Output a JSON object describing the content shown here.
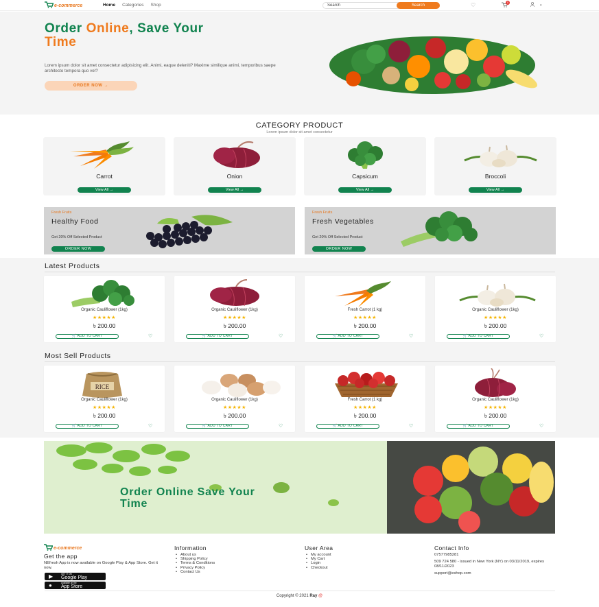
{
  "brand": {
    "name": "e-commerce",
    "colors": {
      "primary_green": "#11834f",
      "accent_orange": "#ef7a1d",
      "star": "#f5b400",
      "hero_bg": "#f4f4f4"
    }
  },
  "nav": {
    "links": [
      {
        "label": "Home",
        "active": true
      },
      {
        "label": "Categories",
        "active": false
      },
      {
        "label": "Shop",
        "active": false
      }
    ],
    "search": {
      "value": "Search",
      "button_label": "Search"
    },
    "icons": [
      "heart-icon",
      "cart-icon",
      "user-icon",
      "chevron-down-icon"
    ],
    "cart_count": "0"
  },
  "hero": {
    "title_part1": "Order ",
    "title_highlight": "Online",
    "title_part2": ", Save Your",
    "title_line3": "Time",
    "description": "Lorem ipsum dolor sit amet consectetur adipisicing elit. Animi, eaque deleniti? Maxime similique animi, temporibus saepe architecto tempora quo vel?",
    "button_label": "ORDER NOW →"
  },
  "category": {
    "title": "CATEGORY PRODUCT",
    "subtitle": "Lorem ipsum dolor sit amet consectetur",
    "items": [
      {
        "name": "Carrot",
        "button_label": "View All →",
        "icon": "carrot-icon"
      },
      {
        "name": "Onion",
        "button_label": "View All →",
        "icon": "onion-icon"
      },
      {
        "name": "Capsicum",
        "button_label": "View All →",
        "icon": "broccoli-icon"
      },
      {
        "name": "Broccoli",
        "button_label": "View All →",
        "icon": "garlic-icon"
      }
    ]
  },
  "promos": [
    {
      "tag": "Fresh Fruits",
      "title": "Healthy Food",
      "description": "Get 20% Off Selected Product",
      "button_label": "ORDER NOW",
      "icon": "grapes-icon"
    },
    {
      "tag": "Fresh Fruits",
      "title": "Fresh Vegetables",
      "description": "Get 20% Off Selected Product",
      "button_label": "ORDER NOW",
      "icon": "broccoli-icon"
    }
  ],
  "latest": {
    "heading": "Latest Products",
    "items": [
      {
        "name": "Organic Cauliflower (1kg)",
        "price": "৳ 200.00",
        "rating": 5,
        "cart_label": "ADD TO CART",
        "icon": "broccoli-icon"
      },
      {
        "name": "Organic Cauliflower (1kg)",
        "price": "৳ 200.00",
        "rating": 5,
        "cart_label": "ADD TO CART",
        "icon": "onion-icon"
      },
      {
        "name": "Fresh Carrot (1 kg)",
        "price": "৳ 200.00",
        "rating": 5,
        "cart_label": "ADD TO CART",
        "icon": "carrot-icon"
      },
      {
        "name": "Organic Cauliflower (1kg)",
        "price": "৳ 200.00",
        "rating": 5,
        "cart_label": "ADD TO CART",
        "icon": "garlic-icon"
      }
    ]
  },
  "most_sell": {
    "heading": "Most Sell Products",
    "items": [
      {
        "name": "Organic Cauliflower (1kg)",
        "price": "৳ 200.00",
        "rating": 5,
        "cart_label": "ADD TO CART",
        "icon": "rice-sack-icon"
      },
      {
        "name": "Organic Cauliflower (1kg)",
        "price": "৳ 200.00",
        "rating": 5,
        "cart_label": "ADD TO CART",
        "icon": "eggs-icon"
      },
      {
        "name": "Fresh Carrot (1 kg)",
        "price": "৳ 200.00",
        "rating": 5,
        "cart_label": "ADD TO CART",
        "icon": "apple-basket-icon"
      },
      {
        "name": "Organic Cauliflower (1kg)",
        "price": "৳ 200.00",
        "rating": 5,
        "cart_label": "ADD TO CART",
        "icon": "onion-icon"
      }
    ]
  },
  "app_banner": {
    "title": "Order Online Save Your Time"
  },
  "footer": {
    "get_app": {
      "heading": "Get the app",
      "text": "NEfresh App is now available on Google Play & App Store. Get it now.",
      "google_small": "GET IT ON",
      "google_big": "Google Play",
      "apple_small": "Available on the",
      "apple_big": "App Store"
    },
    "information": {
      "heading": "Information",
      "links": [
        "About us",
        "Shipping Policy",
        "Terms & Conditions",
        "Privacy Policy",
        "Contact Us"
      ]
    },
    "user_area": {
      "heading": "User Area",
      "links": [
        "My account",
        "My Cart",
        "Login",
        "Checkout"
      ]
    },
    "contact": {
      "heading": "Contact Info",
      "phone": "07577985281",
      "license": "509 724 580 - issued in New York (NY) on 03/11/2019, expires 08/11/2023",
      "email": "support@eshop.com"
    },
    "copyright_prefix": "Copyright © 2021",
    "copyright_name": "Ray",
    "copyright_mark": "@"
  }
}
